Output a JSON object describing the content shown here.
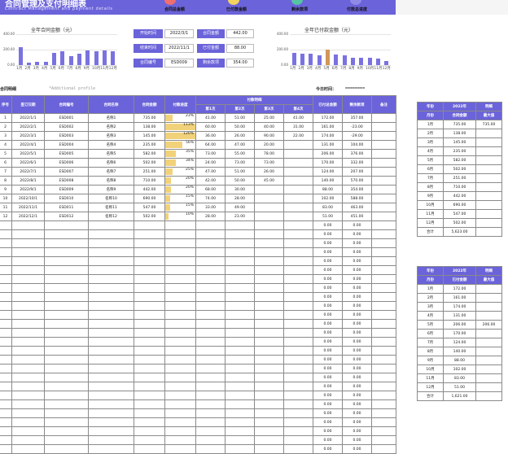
{
  "header": {
    "title": "合同管理及支付明细表",
    "subtitle": "Contract Management and payment details"
  },
  "kpis": [
    {
      "label": "合同总金额",
      "color": "#ef6f6f"
    },
    {
      "label": "已付款金额",
      "color": "#f2d35c"
    },
    {
      "label": "剩余款项",
      "color": "#56c3a3"
    },
    {
      "label": "付款总进度",
      "color": "#8f8ae6"
    }
  ],
  "colors": {
    "accent": "#6b63d9",
    "progress": "#f1d27a",
    "highlight_bar": "#d1965a"
  },
  "chart_data": [
    {
      "type": "bar",
      "title": "全年合同金额（元）",
      "categories": [
        "1月",
        "2月",
        "3月",
        "4月",
        "5月",
        "6月",
        "7月",
        "8月",
        "9月",
        "10月",
        "11月",
        "12月"
      ],
      "yticks": [
        "400.00",
        "200.00",
        "0.00"
      ],
      "ylim": [
        0,
        400
      ],
      "values": [
        235,
        30,
        40,
        40,
        160,
        180,
        120,
        150,
        190,
        180,
        190,
        180
      ]
    },
    {
      "type": "bar",
      "title": "全年已付款金额（元）",
      "categories": [
        "1月",
        "2月",
        "3月",
        "4月",
        "5月",
        "6月",
        "7月",
        "8月",
        "9月",
        "10月",
        "11月",
        "12月"
      ],
      "yticks": [
        "400.00",
        "200.00",
        "0.00"
      ],
      "ylim": [
        0,
        400
      ],
      "values": [
        160,
        150,
        145,
        130,
        205,
        140,
        125,
        95,
        95,
        95,
        85,
        50
      ],
      "highlight_index": 4
    }
  ],
  "filters": [
    {
      "label": "开始时间",
      "value": "2022/3/1",
      "label2": "合同金额",
      "value2": "442.00"
    },
    {
      "label": "结束时间",
      "value": "2022/11/1",
      "label2": "已付金额",
      "value2": "88.00"
    },
    {
      "label": "合同编号",
      "value": "ESD009",
      "label2": "剩余款项",
      "value2": "354.00"
    }
  ],
  "section": {
    "title": "合同明细",
    "hint": "*Additional profile",
    "date_label": "今日时间：",
    "date_value": "========"
  },
  "table": {
    "headers": [
      "序号",
      "签订日期",
      "合同编号",
      "合同名称",
      "合同金额",
      "付款进度"
    ],
    "pay_group": "付款明细",
    "pay_headers": [
      "第1次",
      "第2次",
      "第3次",
      "第4次"
    ],
    "tail_headers": [
      "已付总金额",
      "剩余款项",
      "备注"
    ],
    "rows": [
      {
        "no": "1",
        "date": "2022/1/1",
        "code": "ESD001",
        "name": "名称1",
        "amount": "735.00",
        "pct": "23%",
        "p": 0.23,
        "p1": "41.00",
        "p2": "51.00",
        "p3": "25.00",
        "p4": "41.00",
        "paid": "172.00",
        "rest": "357.00"
      },
      {
        "no": "2",
        "date": "2022/2/1",
        "code": "ESD002",
        "name": "名称2",
        "amount": "138.00",
        "pct": "113%",
        "p": 1,
        "p1": "60.00",
        "p2": "50.00",
        "p3": "40.00",
        "p4": "31.00",
        "paid": "161.00",
        "rest": "-23.00"
      },
      {
        "no": "3",
        "date": "2022/3/1",
        "code": "ESD003",
        "name": "名称3",
        "amount": "145.00",
        "pct": "120%",
        "p": 1,
        "p1": "36.00",
        "p2": "26.00",
        "p3": "90.00",
        "p4": "22.00",
        "paid": "174.00",
        "rest": "-29.00"
      },
      {
        "no": "4",
        "date": "2022/4/1",
        "code": "ESD004",
        "name": "名称4",
        "amount": "235.00",
        "pct": "56%",
        "p": 0.56,
        "p1": "64.00",
        "p2": "47.00",
        "p3": "20.00",
        "p4": "",
        "paid": "131.00",
        "rest": "104.00"
      },
      {
        "no": "5",
        "date": "2022/5/1",
        "code": "ESD005",
        "name": "名称5",
        "amount": "582.00",
        "pct": "35%",
        "p": 0.35,
        "p1": "73.00",
        "p2": "55.00",
        "p3": "78.00",
        "p4": "",
        "paid": "206.00",
        "rest": "376.00"
      },
      {
        "no": "6",
        "date": "2022/6/1",
        "code": "ESD006",
        "name": "名称6",
        "amount": "502.00",
        "pct": "34%",
        "p": 0.34,
        "p1": "24.00",
        "p2": "73.00",
        "p3": "73.00",
        "p4": "",
        "paid": "170.00",
        "rest": "332.00"
      },
      {
        "no": "7",
        "date": "2022/7/1",
        "code": "ESD007",
        "name": "名称7",
        "amount": "251.00",
        "pct": "25%",
        "p": 0.25,
        "p1": "47.00",
        "p2": "51.00",
        "p3": "26.00",
        "p4": "",
        "paid": "124.00",
        "rest": "207.00"
      },
      {
        "no": "8",
        "date": "2022/8/1",
        "code": "ESD008",
        "name": "名称8",
        "amount": "710.00",
        "pct": "20%",
        "p": 0.2,
        "p1": "42.00",
        "p2": "50.00",
        "p3": "45.00",
        "p4": "",
        "paid": "140.00",
        "rest": "570.00"
      },
      {
        "no": "9",
        "date": "2022/9/1",
        "code": "ESD009",
        "name": "名称9",
        "amount": "442.00",
        "pct": "20%",
        "p": 0.2,
        "p1": "68.00",
        "p2": "30.00",
        "p3": "",
        "p4": "",
        "paid": "88.00",
        "rest": "354.00"
      },
      {
        "no": "10",
        "date": "2022/10/1",
        "code": "ESD010",
        "name": "名称10",
        "amount": "690.00",
        "pct": "15%",
        "p": 0.15,
        "p1": "74.00",
        "p2": "28.00",
        "p3": "",
        "p4": "",
        "paid": "102.00",
        "rest": "588.00"
      },
      {
        "no": "11",
        "date": "2022/11/1",
        "code": "ESD011",
        "name": "名称11",
        "amount": "547.00",
        "pct": "15%",
        "p": 0.15,
        "p1": "33.00",
        "p2": "49.00",
        "p3": "",
        "p4": "",
        "paid": "83.00",
        "rest": "463.00"
      },
      {
        "no": "12",
        "date": "2022/12/1",
        "code": "ESD012",
        "name": "名称12",
        "amount": "502.00",
        "pct": "10%",
        "p": 0.1,
        "p1": "28.00",
        "p2": "23.00",
        "p3": "",
        "p4": "",
        "paid": "51.00",
        "rest": "451.00"
      }
    ],
    "empty_paid": "0.00",
    "empty_rest": "0.00"
  },
  "side1": {
    "h1": "年份",
    "h2": "2022年",
    "h3": "明细",
    "h4": "月份",
    "h5": "合同金额",
    "h6": "最大值",
    "rows": [
      [
        "1月",
        "735.00",
        "735.00"
      ],
      [
        "2月",
        "138.00",
        ""
      ],
      [
        "3月",
        "145.00",
        ""
      ],
      [
        "4月",
        "235.00",
        ""
      ],
      [
        "5月",
        "582.00",
        ""
      ],
      [
        "6月",
        "502.00",
        ""
      ],
      [
        "7月",
        "251.00",
        ""
      ],
      [
        "8月",
        "710.00",
        ""
      ],
      [
        "9月",
        "442.00",
        ""
      ],
      [
        "10月",
        "690.00",
        ""
      ],
      [
        "11月",
        "547.00",
        ""
      ],
      [
        "12月",
        "502.00",
        ""
      ]
    ],
    "total_label": "合计",
    "total": "5,623.00"
  },
  "side2": {
    "h1": "年份",
    "h2": "2022年",
    "h3": "明细",
    "h4": "月份",
    "h5": "已付金额",
    "h6": "最大值",
    "rows": [
      [
        "1月",
        "172.00",
        ""
      ],
      [
        "2月",
        "161.00",
        ""
      ],
      [
        "3月",
        "174.00",
        ""
      ],
      [
        "4月",
        "131.00",
        ""
      ],
      [
        "5月",
        "206.00",
        "206.00"
      ],
      [
        "6月",
        "170.00",
        ""
      ],
      [
        "7月",
        "124.00",
        ""
      ],
      [
        "8月",
        "140.00",
        ""
      ],
      [
        "9月",
        "88.00",
        ""
      ],
      [
        "10月",
        "102.00",
        ""
      ],
      [
        "11月",
        "83.00",
        ""
      ],
      [
        "12月",
        "51.00",
        ""
      ]
    ],
    "total_label": "合计",
    "total": "1,621.00"
  }
}
